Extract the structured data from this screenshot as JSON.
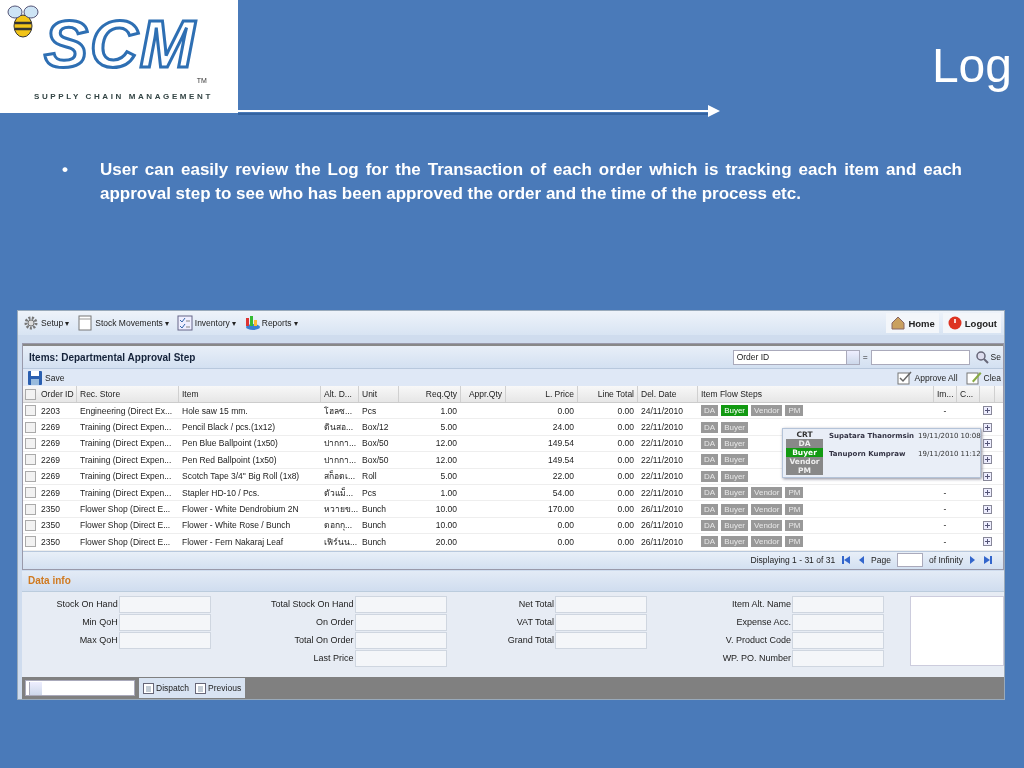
{
  "slide": {
    "logo": {
      "wordmark": "SCM",
      "trademark": "TM",
      "tagline": "SUPPLY CHAIN MANAGEMENT"
    },
    "title": "Log",
    "bullets": [
      {
        "marker": "•",
        "text": "User can easily review the Log for the Transaction of each order  which is tracking each item and each approval step to see who has been approved the order and the time of the process etc."
      }
    ]
  },
  "app": {
    "menu": [
      {
        "label": "Setup",
        "caret": "▾",
        "kind": "gear"
      },
      {
        "label": "Stock Movements",
        "caret": "▾",
        "kind": "sheet"
      },
      {
        "label": "Inventory",
        "caret": "▾",
        "kind": "checklist"
      },
      {
        "label": "Reports",
        "caret": "▾",
        "kind": "chart"
      }
    ],
    "nav": [
      {
        "label": "Home",
        "kind": "home"
      },
      {
        "label": "Logout",
        "kind": "power"
      }
    ],
    "panel_title": "Items: Departmental Approval Step",
    "filter": {
      "field": "Order ID",
      "operator": "=",
      "search_label": "Se"
    },
    "toolbar": {
      "left": [
        {
          "label": "Save",
          "kind": "disk"
        }
      ],
      "right": [
        {
          "label": "Approve All",
          "kind": "approve"
        },
        {
          "label": "Clea",
          "kind": "edit"
        }
      ]
    },
    "table": {
      "header_checked": false,
      "columns": [
        "Order ID",
        "Rec. Store",
        "Item",
        "Alt. D...",
        "Unit",
        "Req.Qty",
        "Appr.Qty",
        "L. Price",
        "Line Total",
        "Del. Date",
        "Item Flow Steps",
        "Im...",
        "C..."
      ],
      "rows": [
        {
          "checked": false,
          "cells": [
            "2203",
            "Engineering (Direct Ex...",
            "Hole saw 15 mm.",
            "โฮลซ...",
            "Pcs",
            "1.00",
            null,
            "0.00",
            "0.00",
            "24/11/2010"
          ],
          "im": "-",
          "steps": [
            {
              "label": "DA",
              "done": false
            },
            {
              "label": "Buyer",
              "done": true
            },
            {
              "label": "Vendor",
              "done": false
            },
            {
              "label": "PM",
              "done": false
            }
          ]
        },
        {
          "checked": false,
          "cells": [
            "2269",
            "Training (Direct Expen...",
            "Pencil Black / pcs.(1x12)",
            "ดินสอ...",
            "Box/12",
            "5.00",
            null,
            "24.00",
            "0.00",
            "22/11/2010"
          ],
          "steps": [
            {
              "label": "DA",
              "done": false
            },
            {
              "label": "Buyer",
              "done": false
            }
          ]
        },
        {
          "checked": false,
          "cells": [
            "2269",
            "Training (Direct Expen...",
            "Pen Blue Ballpoint (1x50)",
            "ปากกา...",
            "Box/50",
            "12.00",
            null,
            "149.54",
            "0.00",
            "22/11/2010"
          ],
          "steps": [
            {
              "label": "DA",
              "done": false
            },
            {
              "label": "Buyer",
              "done": false
            }
          ]
        },
        {
          "checked": false,
          "cells": [
            "2269",
            "Training (Direct Expen...",
            "Pen Red Ballpoint (1x50)",
            "ปากกา...",
            "Box/50",
            "12.00",
            null,
            "149.54",
            "0.00",
            "22/11/2010"
          ],
          "steps": [
            {
              "label": "DA",
              "done": false
            },
            {
              "label": "Buyer",
              "done": false
            }
          ]
        },
        {
          "checked": false,
          "cells": [
            "2269",
            "Training (Direct Expen...",
            "Scotch Tape 3/4\" Big Roll (1x8)",
            "สก็อตเ...",
            "Roll",
            "5.00",
            null,
            "22.00",
            "0.00",
            "22/11/2010"
          ],
          "steps": [
            {
              "label": "DA",
              "done": false
            },
            {
              "label": "Buyer",
              "done": false
            }
          ]
        },
        {
          "checked": false,
          "cells": [
            "2269",
            "Training (Direct Expen...",
            "Stapler HD-10 / Pcs.",
            "ตัวแม็...",
            "Pcs",
            "1.00",
            null,
            "54.00",
            "0.00",
            "22/11/2010"
          ],
          "im": "-",
          "steps": [
            {
              "label": "DA",
              "done": false
            },
            {
              "label": "Buyer",
              "done": false
            },
            {
              "label": "Vendor",
              "done": false
            },
            {
              "label": "PM",
              "done": false
            }
          ]
        },
        {
          "checked": false,
          "cells": [
            "2350",
            "Flower Shop (Direct E...",
            "Flower - White Dendrobium 2N",
            "หวายข...",
            "Bunch",
            "10.00",
            null,
            "170.00",
            "0.00",
            "26/11/2010"
          ],
          "im": "-",
          "steps": [
            {
              "label": "DA",
              "done": false
            },
            {
              "label": "Buyer",
              "done": false
            },
            {
              "label": "Vendor",
              "done": false
            },
            {
              "label": "PM",
              "done": false
            }
          ]
        },
        {
          "checked": false,
          "cells": [
            "2350",
            "Flower Shop (Direct E...",
            "Flower - White Rose / Bunch",
            "ดอกกุ...",
            "Bunch",
            "10.00",
            null,
            "0.00",
            "0.00",
            "26/11/2010"
          ],
          "im": "-",
          "steps": [
            {
              "label": "DA",
              "done": false
            },
            {
              "label": "Buyer",
              "done": false
            },
            {
              "label": "Vendor",
              "done": false
            },
            {
              "label": "PM",
              "done": false
            }
          ]
        },
        {
          "checked": false,
          "cells": [
            "2350",
            "Flower Shop (Direct E...",
            "Flower - Fern Nakaraj Leaf",
            "เฟิร์นน...",
            "Bunch",
            "20.00",
            null,
            "0.00",
            "0.00",
            "26/11/2010"
          ],
          "im": "-",
          "steps": [
            {
              "label": "DA",
              "done": false
            },
            {
              "label": "Buyer",
              "done": false
            },
            {
              "label": "Vendor",
              "done": false
            },
            {
              "label": "PM",
              "done": false
            }
          ]
        }
      ]
    },
    "popup": {
      "steps": [
        {
          "label": "CRT",
          "kind": "text"
        },
        {
          "label": "DA",
          "kind": "badge",
          "done": false
        },
        {
          "label": "Buyer",
          "kind": "badge",
          "done": true
        },
        {
          "label": "Vendor",
          "kind": "badge",
          "done": false
        },
        {
          "label": "PM",
          "kind": "badge",
          "done": false
        }
      ],
      "entries": [
        {
          "name": "Supatara Thanormsin",
          "time": "19/11/2010 10:08"
        },
        {
          "name": "Tanuporn Kumpraw",
          "time": "19/11/2010 11:12"
        }
      ]
    },
    "paging": {
      "display": "Displaying 1 - 31 of 31",
      "page_label": "Page",
      "of_label": "of Infinity"
    },
    "data_info": {
      "title": "Data info",
      "groups": [
        [
          "Stock On Hand",
          "Min QoH",
          "Max QoH"
        ],
        [
          "Total Stock On Hand",
          "On Order",
          "Total On Order",
          "Last Price"
        ],
        [
          "Net Total",
          "VAT Total",
          "Grand Total"
        ],
        [
          "Item Alt. Name",
          "Expense Acc.",
          "V. Product Code",
          "WP. PO. Number"
        ]
      ]
    },
    "bottom": {
      "buttons": [
        "Dispatch",
        "Previous"
      ]
    }
  }
}
